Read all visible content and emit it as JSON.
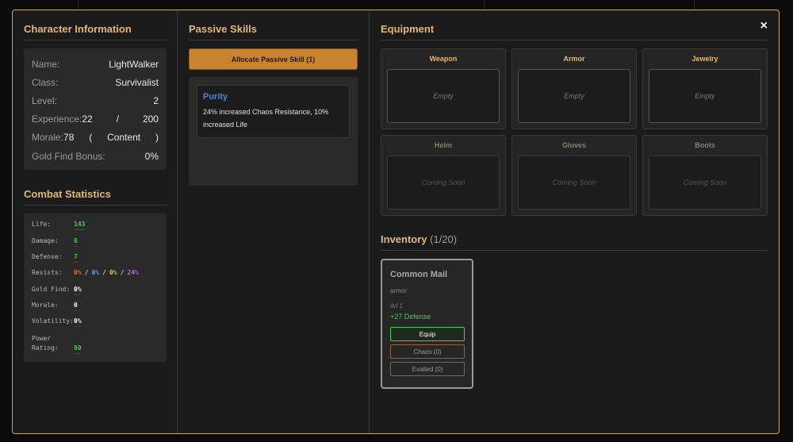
{
  "character": {
    "title": "Character Information",
    "name_label": "Name:",
    "name": "LightWalker",
    "class_label": "Class:",
    "class": "Survivalist",
    "level_label": "Level:",
    "level": "2",
    "exp_label": "Experience:",
    "exp_current": "22",
    "exp_sep": "/",
    "exp_max": "200",
    "morale_label": "Morale:",
    "morale_value": "78",
    "morale_open": "(",
    "morale_state": "Content",
    "morale_close": ")",
    "gold_label": "Gold Find Bonus:",
    "gold_value": "0%"
  },
  "combat": {
    "title": "Combat Statistics",
    "life_label": "Life:",
    "life": "143",
    "damage_label": "Damage:",
    "damage": "8",
    "defense_label": "Defense:",
    "defense": "7",
    "resists_label": "Resists:",
    "resist_fire": "0%",
    "resist_cold": "0%",
    "resist_lightning": "0%",
    "resist_chaos": "24%",
    "resist_sep": "/",
    "gold_label": "Gold Find:",
    "gold": "0%",
    "morale_label": "Morale:",
    "morale": "0",
    "volatility_label": "Volatility:",
    "volatility": "0%",
    "power_label_1": "Power",
    "power_label_2": "Rating:",
    "power": "80"
  },
  "passive": {
    "title": "Passive Skills",
    "allocate_label": "Allocate Passive Skill (1)",
    "skills": [
      {
        "name": "Purity",
        "desc": "24% increased Chaos Resistance, 10% increased Life"
      }
    ]
  },
  "equipment": {
    "title": "Equipment",
    "slots": [
      {
        "label": "Weapon",
        "status": "Empty"
      },
      {
        "label": "Armor",
        "status": "Empty"
      },
      {
        "label": "Jewelry",
        "status": "Empty"
      },
      {
        "label": "Helm",
        "status": "Coming Soon"
      },
      {
        "label": "Gloves",
        "status": "Coming Soon"
      },
      {
        "label": "Boots",
        "status": "Coming Soon"
      }
    ]
  },
  "inventory": {
    "title": "Inventory",
    "count": "(1/20)",
    "items": [
      {
        "name": "Common Mail",
        "type": "armor",
        "ilvl": "ilvl 1",
        "mod": "+27 Defense",
        "equip_label": "Equip",
        "chaos_label": "Chaos (0)",
        "exalted_label": "Exalted (0)"
      }
    ]
  },
  "close_label": "×",
  "colors": {
    "accent": "#e0b878",
    "border": "#c9a76a",
    "button": "#c8842e",
    "good": "#4bc95a",
    "skill": "#4a84d8"
  }
}
